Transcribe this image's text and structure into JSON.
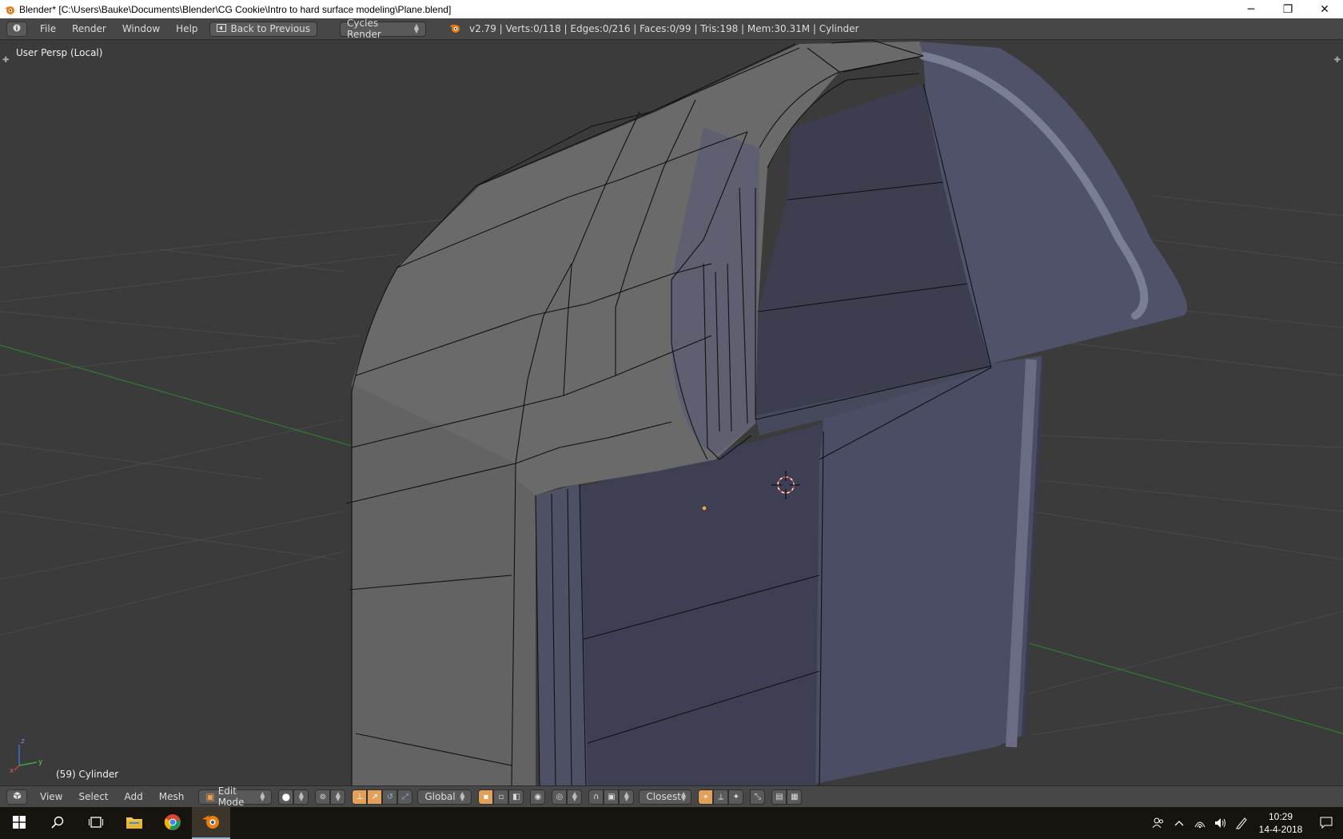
{
  "window": {
    "title": "Blender* [C:\\Users\\Bauke\\Documents\\Blender\\CG Cookie\\Intro to hard surface modeling\\Plane.blend]",
    "minimize_glyph": "─",
    "restore_glyph": "❐",
    "close_glyph": "✕"
  },
  "info_header": {
    "menus": [
      "File",
      "Render",
      "Window",
      "Help"
    ],
    "back_label": "Back to Previous",
    "render_engine": "Cycles Render",
    "stats": "v2.79 | Verts:0/118 | Edges:0/216 | Faces:0/99 | Tris:198 | Mem:30.31M | Cylinder"
  },
  "viewport": {
    "view_name": "User Persp (Local)",
    "object_label": "(59) Cylinder",
    "axis_labels": {
      "x": "x",
      "y": "y",
      "z": "z"
    }
  },
  "view_header": {
    "menus": [
      "View",
      "Select",
      "Add",
      "Mesh"
    ],
    "mode": "Edit Mode",
    "orientation": "Global",
    "snap_target": "Closest"
  },
  "taskbar": {
    "time": "10:29",
    "date": "14-4-2018"
  },
  "colors": {
    "accent": "#e3a05a",
    "viewport_bg": "#3b3b3b",
    "header_bg": "#474747",
    "grid_green": "#2e7d2e"
  }
}
